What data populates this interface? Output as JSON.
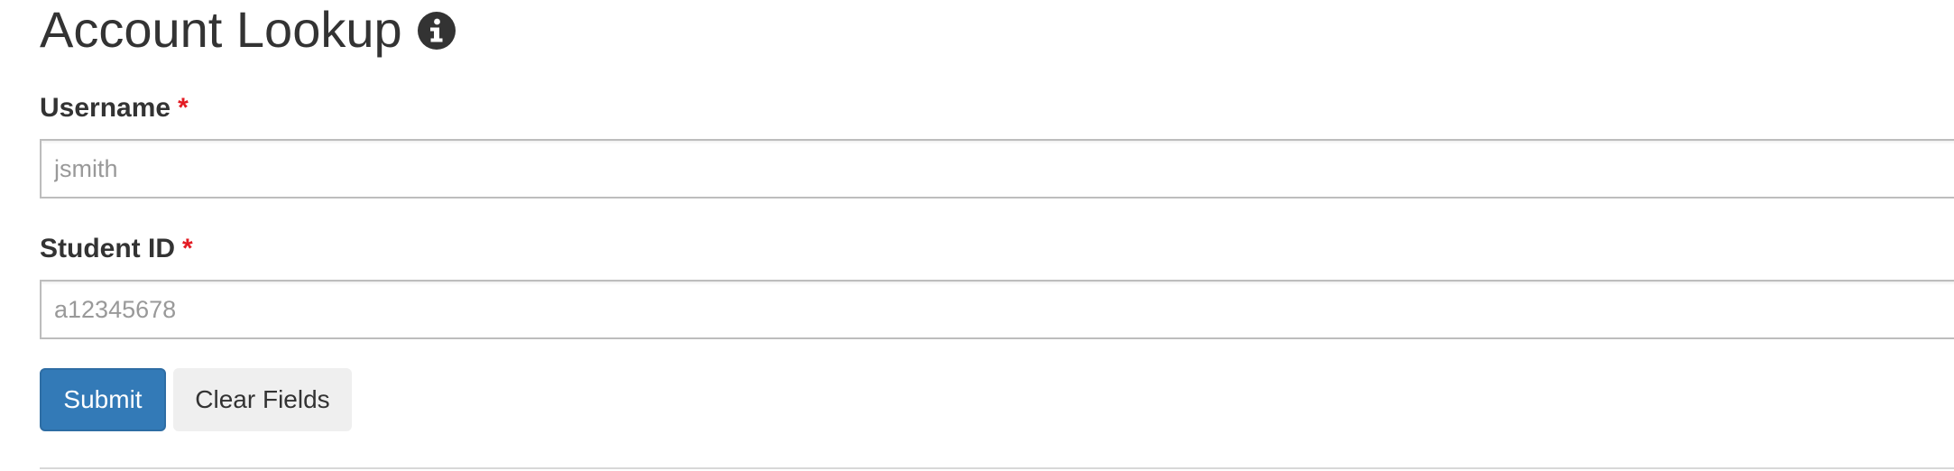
{
  "page": {
    "title": "Account Lookup",
    "info_icon": "info-circle-icon"
  },
  "form": {
    "username": {
      "label": "Username",
      "required_marker": "*",
      "placeholder": "jsmith",
      "value": ""
    },
    "student_id": {
      "label": "Student ID",
      "required_marker": "*",
      "placeholder": "a12345678",
      "value": ""
    },
    "submit_label": "Submit",
    "clear_label": "Clear Fields"
  },
  "colors": {
    "primary": "#337ab7",
    "required": "#e31b23",
    "text": "#333333"
  }
}
